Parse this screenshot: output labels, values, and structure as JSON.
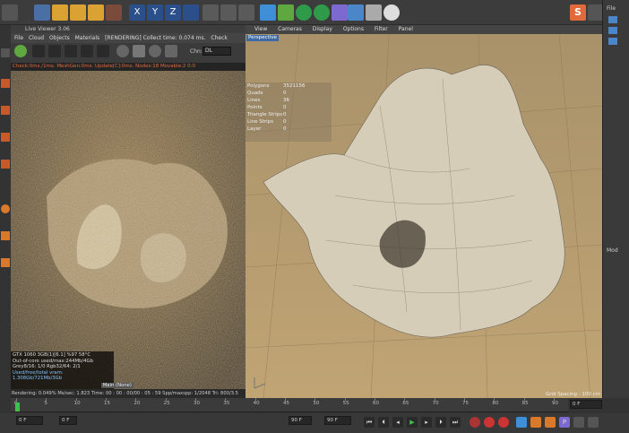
{
  "live_viewer": {
    "title": "Live Viewer 3.06",
    "menu": [
      "File",
      "Cloud",
      "Objects",
      "Materials",
      "[RENDERING] Collect time: 0.074 ms.",
      "Check"
    ],
    "chn_label": "Chn:",
    "chn_value": "DL",
    "status": "Check:0ms./1ms. MeshGen:0ms. Update[C]:0ms. Nodes:18 Movable:2  0:0",
    "info": [
      "GTX 1060 3GB(1)[6.1]      %97     58°C",
      "Out-of-core used/max:244Mb/4Gb",
      "Grey8/16: 1/0                Rgb32/64: 2/1",
      "Used/free/total vram: 1.308Gb/721Mb/3Gb"
    ],
    "info_tag": "Main (None)",
    "bottom": "Rendering: 0.049%  Ms/sec: 1.823     Time: 00 : 00 : 00/00 : 05 : 59     Spp/maxspp: 1/2048   Tri: 800/3.5",
    "render_colors": {
      "sand": "#7a6236",
      "shell": "#c9b38a"
    }
  },
  "viewport": {
    "menu": [
      "View",
      "Cameras",
      "Display",
      "Options",
      "Filter",
      "Panel"
    ],
    "label": "Perspective",
    "stats": [
      {
        "k": "Polygons",
        "v": "3521156"
      },
      {
        "k": "Quads",
        "v": "0"
      },
      {
        "k": "Lines",
        "v": "36"
      },
      {
        "k": "Points",
        "v": "0"
      },
      {
        "k": "Triangle Strips",
        "v": "0"
      },
      {
        "k": "Line Strips",
        "v": "0"
      },
      {
        "k": "Layer",
        "v": "0"
      }
    ],
    "grid_spacing": "Grid Spacing : 100 cm"
  },
  "right_panel": {
    "file": "File",
    "item": "Mod"
  },
  "timeline": {
    "ticks": [
      "0",
      "5",
      "10",
      "15",
      "20",
      "25",
      "30",
      "35",
      "40",
      "45",
      "50",
      "55",
      "60",
      "65",
      "70",
      "75",
      "80",
      "85",
      "90"
    ],
    "start_field": "0 F",
    "start_field2": "0 F",
    "end_field": "90 F",
    "end_field2": "90 F",
    "current_frame": "0 F"
  },
  "colors": {
    "accent": "#3f6aa8",
    "orange": "#e26a3a"
  }
}
